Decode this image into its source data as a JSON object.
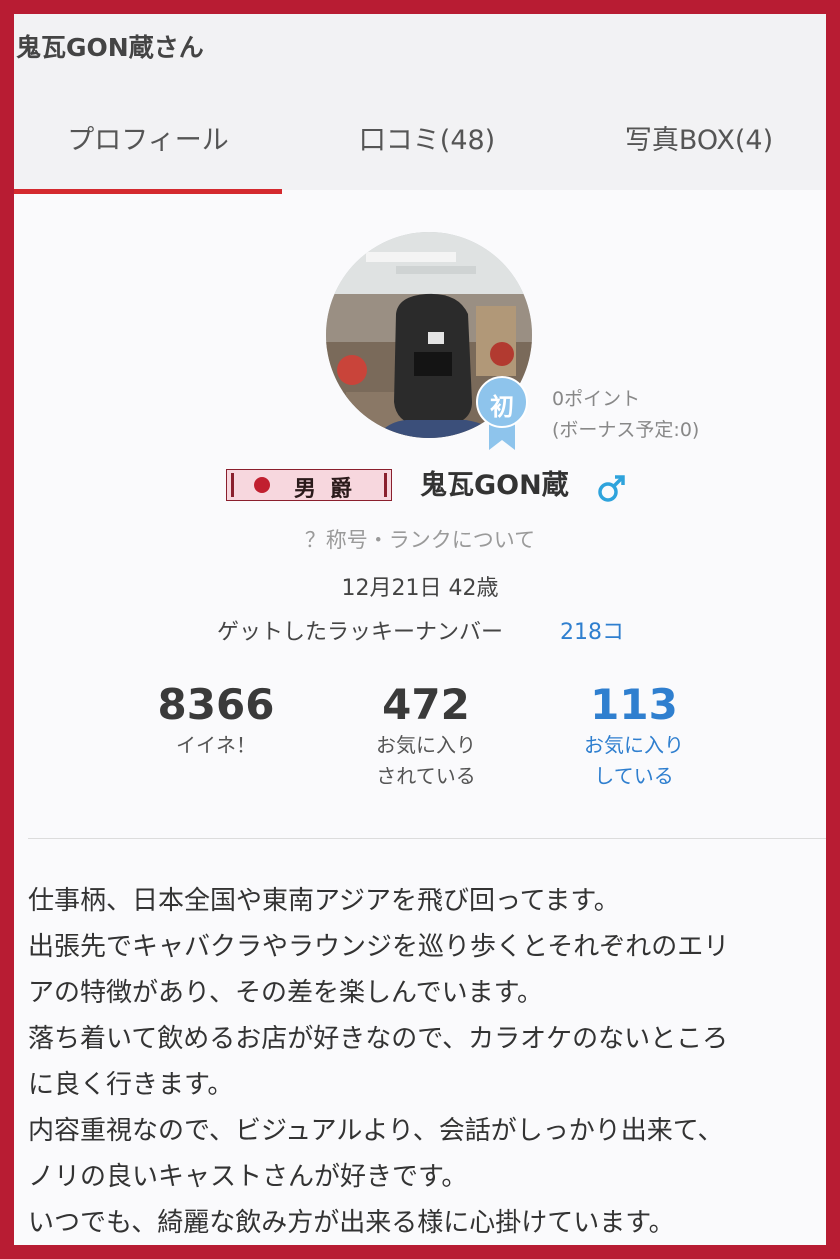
{
  "page_title": "鬼瓦GON蔵さん",
  "tabs": [
    {
      "label": "プロフィール"
    },
    {
      "label": "口コミ(48)"
    },
    {
      "label": "写真BOX(4)"
    }
  ],
  "profile": {
    "badge_text": "初",
    "points": "0ポイント",
    "bonus": "(ボーナス予定:0)",
    "rank_label": "男爵",
    "name": "鬼瓦GON蔵",
    "gender_symbol": "♂",
    "rank_link": "？称号・ランクについて",
    "birth_age": "12月21日 42歳",
    "lucky_label": "ゲットしたラッキーナンバー",
    "lucky_value": "218コ"
  },
  "stats": [
    {
      "value": "8366",
      "line1": "イイネ！",
      "line2": ""
    },
    {
      "value": "472",
      "line1": "お気に入り",
      "line2": "されている"
    },
    {
      "value": "113",
      "line1": "お気に入り",
      "line2": "している"
    }
  ],
  "bio_lines": [
    "仕事柄、日本全国や東南アジアを飛び回ってます。",
    "出張先でキャバクラやラウンジを巡り歩くとそれぞれのエリ",
    "アの特徴があり、その差を楽しんでいます。",
    "落ち着いて飲めるお店が好きなので、カラオケのないところ",
    "に良く行きます。",
    "内容重視なので、ビジュアルより、会話がしっかり出来て、",
    "ノリの良いキャストさんが好きです。",
    "いつでも、綺麗な飲み方が出来る様に心掛けています。"
  ],
  "colors": {
    "border": "#b81c33",
    "accent_red": "#d42a2f",
    "link_blue": "#2f7fcf",
    "badge_blue": "#8ec4ec"
  },
  "icons": {
    "badge": "ribbon-badge-icon",
    "gender": "male-symbol-icon"
  }
}
